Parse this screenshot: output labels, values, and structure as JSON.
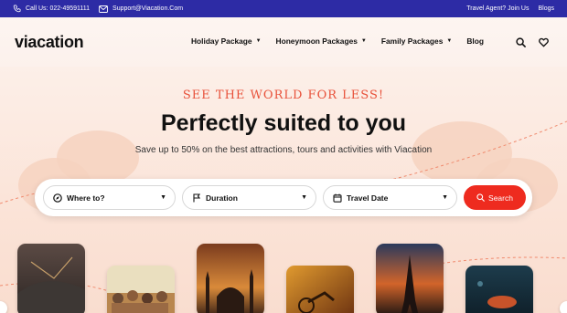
{
  "topbar": {
    "phone_label": "Call Us: 022-49591111",
    "email_label": "Support@Viacation.Com",
    "travel_agent_label": "Travel Agent? Join Us",
    "blogs_label": "Blogs"
  },
  "header": {
    "logo_text": "viacation",
    "nav": [
      {
        "label": "Holiday Package",
        "has_dropdown": true
      },
      {
        "label": "Honeymoon Packages",
        "has_dropdown": true
      },
      {
        "label": "Family Packages",
        "has_dropdown": true
      },
      {
        "label": "Blog",
        "has_dropdown": false
      }
    ],
    "icons": [
      "search-icon",
      "heart-icon"
    ]
  },
  "hero": {
    "tagline": "SEE THE WORLD FOR LESS!",
    "title": "Perfectly suited to you",
    "subtitle": "Save up to 50% on the best attractions, tours and activities with Viacation"
  },
  "search": {
    "where_label": "Where to?",
    "duration_label": "Duration",
    "date_label": "Travel Date",
    "button_label": "Search"
  },
  "cards": [
    "stormy-sky-photo",
    "crowd-photo",
    "mosque-sunset-photo",
    "motorbike-sunset-photo",
    "eiffel-tower-photo",
    "underwater-photo"
  ],
  "colors": {
    "topbar": "#2d2ba5",
    "accent": "#ee2b1f",
    "tagline": "#e8513a",
    "background": "#fbe9e0"
  }
}
